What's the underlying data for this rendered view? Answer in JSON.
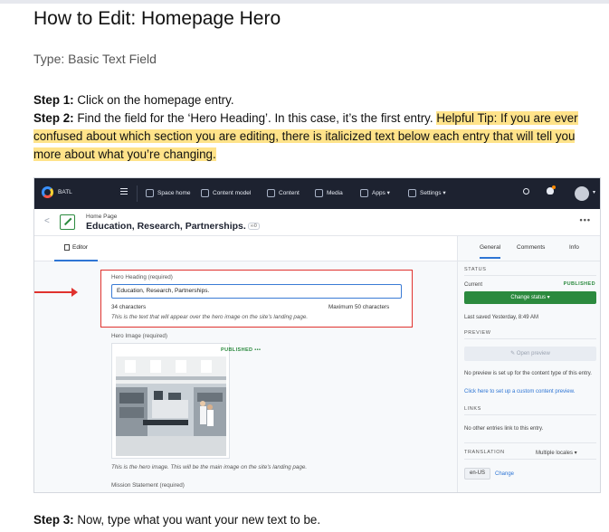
{
  "doc": {
    "title": "How to Edit: Homepage Hero",
    "type_line": "Type: Basic Text Field",
    "step1_label": "Step 1:",
    "step1_text": " Click on the homepage entry.",
    "step2_label": "Step 2:",
    "step2_text": " Find the field for the ‘Hero Heading’. In this case, it’s the first entry. ",
    "step2_tip": "Helpful Tip: If you are ever confused about which section you are editing, there is italicized text below each entry that will tell you more about what you’re changing.",
    "step3_label": "Step 3:",
    "step3_text": " Now, type what you want your new text to be.",
    "highlight_color": "#ffe38a"
  },
  "screenshot": {
    "nav": {
      "space_name": "BATL",
      "items": [
        "Space home",
        "Content model",
        "Content",
        "Media",
        "Apps",
        "Settings"
      ],
      "apps_chevron": "▾",
      "settings_chevron": "▾",
      "avatar_chevron": "▾",
      "bg_color": "#1d2230"
    },
    "entry": {
      "content_type": "Home Page",
      "title": "Education, Research, Partnerships.",
      "ref_tag": "∞0",
      "more": "•••"
    },
    "editor_tab": "Editor",
    "fields": {
      "hero_heading_label": "Hero Heading (required)",
      "hero_heading_value": "Education, Research, Partnerships.",
      "char_count": "34 characters",
      "max_chars": "Maximum 50 characters",
      "hero_heading_help": "This is the text that will appear over the hero image on the site's landing page.",
      "hero_image_label": "Hero Image (required)",
      "hero_image_status": "PUBLISHED •••",
      "hero_image_help": "This is the hero image. This will be the main image on the site's landing page.",
      "mission_label": "Mission Statement (required)"
    },
    "sidebar": {
      "tabs": [
        "General",
        "Comments",
        "Info"
      ],
      "status_heading": "STATUS",
      "current_label": "Current",
      "current_value": "PUBLISHED",
      "change_status": "Change status ▾",
      "last_saved": "Last saved Yesterday, 8:49 AM",
      "preview_heading": "PREVIEW",
      "open_preview": "Open preview",
      "no_preview": "No preview is set up for the content type of this entry.",
      "setup_preview_link": "Click here to set up a custom content preview.",
      "links_heading": "LINKS",
      "no_links": "No other entries link to this entry.",
      "translation_heading": "TRANSLATION",
      "locales_select": "Multiple locales ▾",
      "locale_chip": "en-US",
      "change_link": "Change"
    },
    "accent_colors": {
      "published_green": "#2b8a3e",
      "link_blue": "#2e75d4",
      "annotation_red": "#e0322e"
    }
  }
}
